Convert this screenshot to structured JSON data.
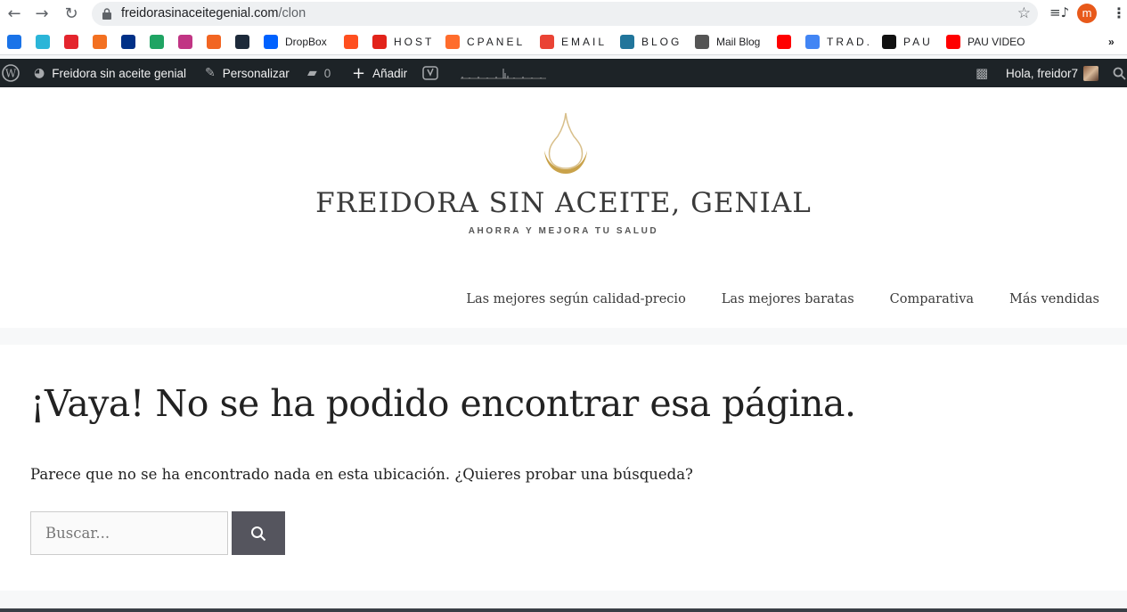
{
  "browser": {
    "url_domain": "freidorasinaceitegenial.com",
    "url_path": "/clon",
    "profile_initial": "m",
    "bookmarks": [
      {
        "label": "",
        "icon": "c-icon",
        "color": "#1a73e8"
      },
      {
        "label": "",
        "icon": "play-icon",
        "color": "#2bb5d8"
      },
      {
        "label": "",
        "icon": "pocket-icon",
        "color": "#e4252d"
      },
      {
        "label": "",
        "icon": "calendar-icon",
        "color": "#f37021"
      },
      {
        "label": "",
        "icon": "paypal-icon",
        "color": "#003087"
      },
      {
        "label": "",
        "icon": "drive-icon",
        "color": "#1fa463"
      },
      {
        "label": "",
        "icon": "instagram-icon",
        "color": "#c13584"
      },
      {
        "label": "",
        "icon": "om-icon",
        "color": "#f26522"
      },
      {
        "label": "",
        "icon": "squares-icon",
        "color": "#1d2a3a"
      },
      {
        "label": "DropBox",
        "icon": "dropbox-icon",
        "color": "#0061fe"
      },
      {
        "label": "",
        "icon": "n-icon",
        "color": "#ff4f1f"
      },
      {
        "label": "HOST",
        "icon": "w-icon",
        "color": "#e2231a"
      },
      {
        "label": "CPANEL",
        "icon": "cpanel-icon",
        "color": "#ff6c2c"
      },
      {
        "label": "EMAIL",
        "icon": "gmail-icon",
        "color": "#ea4335"
      },
      {
        "label": "BLOG",
        "icon": "wordpress-icon",
        "color": "#21759b"
      },
      {
        "label": "Mail Blog",
        "icon": "mail-icon",
        "color": "#555555"
      },
      {
        "label": "",
        "icon": "youtube-icon",
        "color": "#ff0000"
      },
      {
        "label": "TRAD.",
        "icon": "translate-icon",
        "color": "#4285f4"
      },
      {
        "label": "PAU",
        "icon": "vo-icon",
        "color": "#111111"
      },
      {
        "label": "PAU VIDEO",
        "icon": "youtube-icon",
        "color": "#ff0000"
      }
    ],
    "overflow": "»"
  },
  "wpbar": {
    "site_name": "Freidora sin aceite genial",
    "customize": "Personalizar",
    "comments_count": "0",
    "add_new": "Añadir",
    "greeting": "Hola, freidor7"
  },
  "site": {
    "title": "FREIDORA SIN ACEITE, GENIAL",
    "tagline": "AHORRA Y MEJORA TU SALUD",
    "nav": [
      "Las mejores según calidad-precio",
      "Las mejores baratas",
      "Comparativa",
      "Más vendidas"
    ],
    "accent_color": "#c9a24a"
  },
  "page": {
    "heading": "¡Vaya! No se ha podido encontrar esa página.",
    "message": "Parece que no se ha encontrado nada en esta ubicación. ¿Quieres probar una búsqueda?",
    "search_placeholder": "Buscar..."
  }
}
